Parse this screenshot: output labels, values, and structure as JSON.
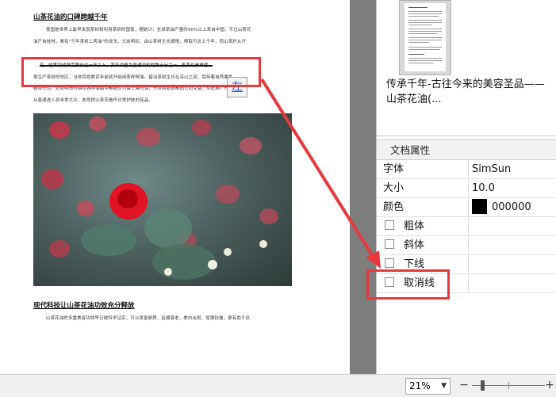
{
  "document": {
    "heading1": "山茶花油的口碑跨越千年",
    "para1_lines": [
      "我国是世界上最早发现茶树和利用茶树的国家，据统计，全球茶油产量的90%以上来自中国。不过山茶花",
      "油产自桂林，素有\"千年茶树二两油\"的说法。元末明初，由山茶树生长缓慢，榨取可达上千年，而山茶籽从开"
    ],
    "para2_lines": [
      "花、结果到成熟需要长达一年以上，其产油量为普通油料的数十分之一，极其珍贵难得。",
      "虽生产茶树的地区，当地百姓数百年前就开始用茶籽榨油。碧泊茶树生长在深山之间，保持着自然属性，",
      "被视光性。达到明清时期在各种油脂中都被认为最上乘的油，头发和肌肤都因它而受益，从此推广开来。",
      "从普通进入到寻常大众，依然把山茶花看作日常护肤的佳品。"
    ],
    "float_button_label": "左",
    "heading2": "现代科技让山茶花油功效充分释放",
    "para3_lines": [
      "山茶花油的多重美容功效早已被科学证实，可以改善肤质，延缓衰老，美白淡斑，增弹抗皱，更有助于抗"
    ]
  },
  "thumbnail": {
    "title": "传承千年-古往今来的美容圣品——山茶花油(..."
  },
  "properties": {
    "header": "文档属性",
    "rows": [
      {
        "label": "字体",
        "value": "SimSun"
      },
      {
        "label": "大小",
        "value": "10.0"
      },
      {
        "label": "颜色",
        "value": "000000"
      }
    ],
    "color_swatch": "#000000",
    "checkboxes": [
      {
        "label": "粗体",
        "checked": false
      },
      {
        "label": "斜体",
        "checked": false
      },
      {
        "label": "下线",
        "checked": false
      },
      {
        "label": "取消线",
        "checked": false
      }
    ]
  },
  "statusbar": {
    "zoom_value": "21%"
  },
  "colors": {
    "annotation": "#e8383d",
    "doc_background": "#7d7d7d"
  }
}
